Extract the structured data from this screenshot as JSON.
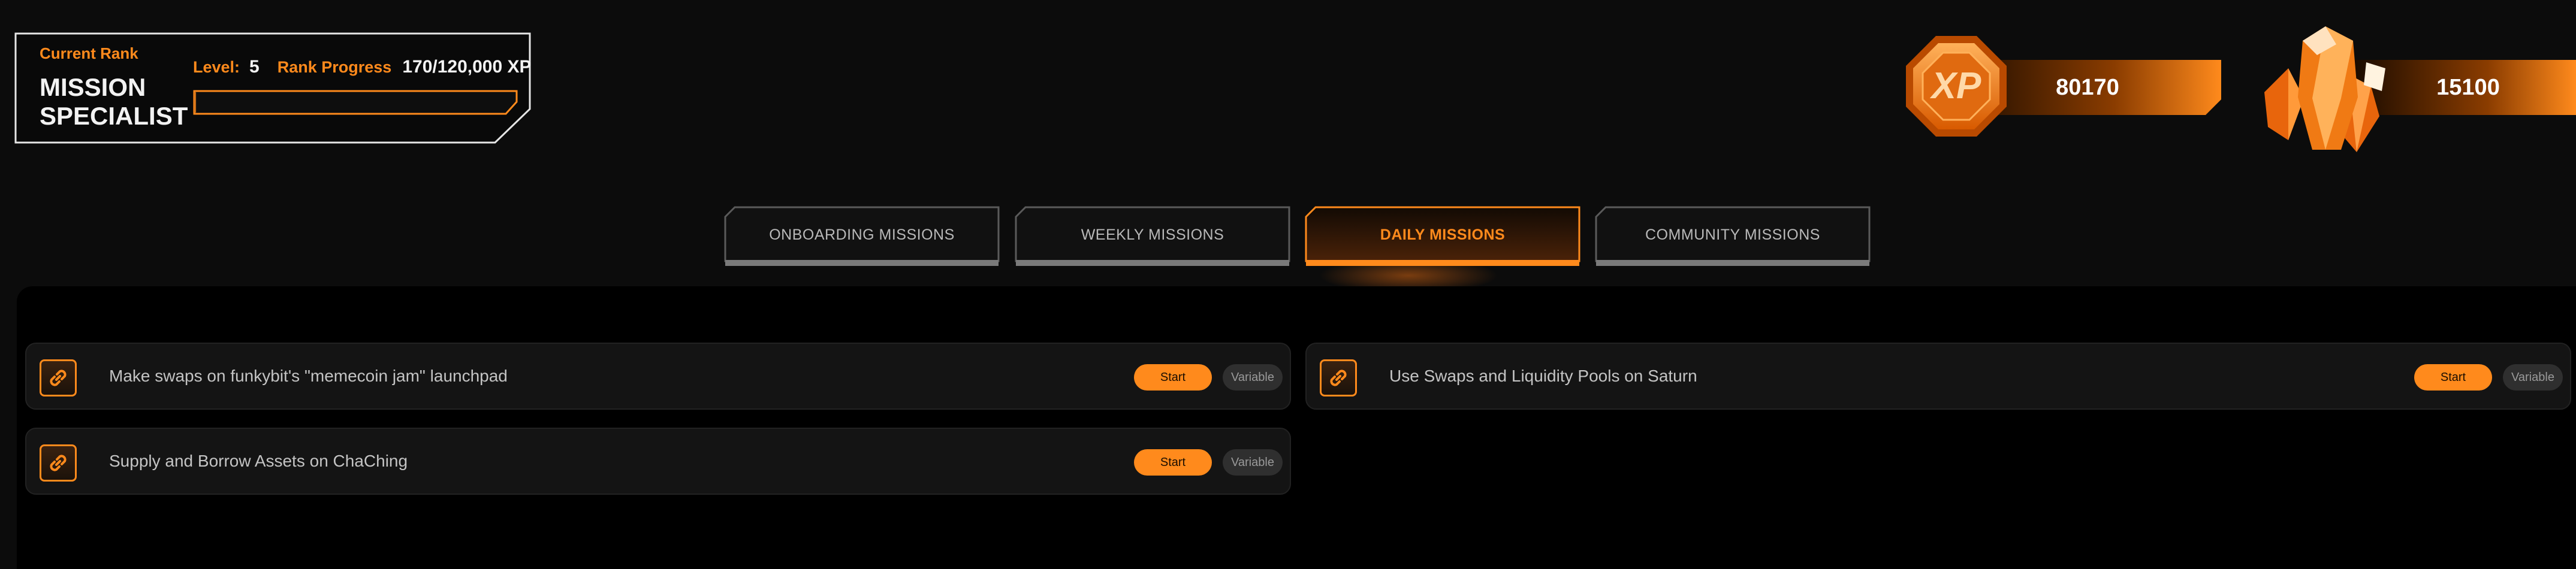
{
  "rank": {
    "heading": "Current Rank",
    "name": "MISSION SPECIALIST",
    "level_label": "Level:",
    "level_value": "5",
    "progress_label": "Rank Progress",
    "progress_value": "170/120,000 XP",
    "progress_fraction": 0.0014
  },
  "currencies": {
    "xp": {
      "icon": "xp-badge-icon",
      "badge_text": "XP",
      "amount": "80170"
    },
    "crystals": {
      "icon": "orange-crystal-icon",
      "amount": "15100"
    }
  },
  "tabs": [
    {
      "label": "ONBOARDING MISSIONS",
      "active": false
    },
    {
      "label": "WEEKLY MISSIONS",
      "active": false
    },
    {
      "label": "DAILY MISSIONS",
      "active": true
    },
    {
      "label": "COMMUNITY MISSIONS",
      "active": false
    }
  ],
  "missions": [
    {
      "icon": "link-icon",
      "title": "Make swaps on funkybit's \"memecoin jam\" launchpad",
      "start_label": "Start",
      "reward_label": "Variable"
    },
    {
      "icon": "link-icon",
      "title": "Use Swaps and Liquidity Pools on Saturn",
      "start_label": "Start",
      "reward_label": "Variable"
    },
    {
      "icon": "link-icon",
      "title": "Supply and Borrow Assets on ChaChing",
      "start_label": "Start",
      "reward_label": "Variable"
    }
  ],
  "colors": {
    "accent": "#ff8a1c",
    "background": "#0c0c0c",
    "card": "#141414"
  }
}
